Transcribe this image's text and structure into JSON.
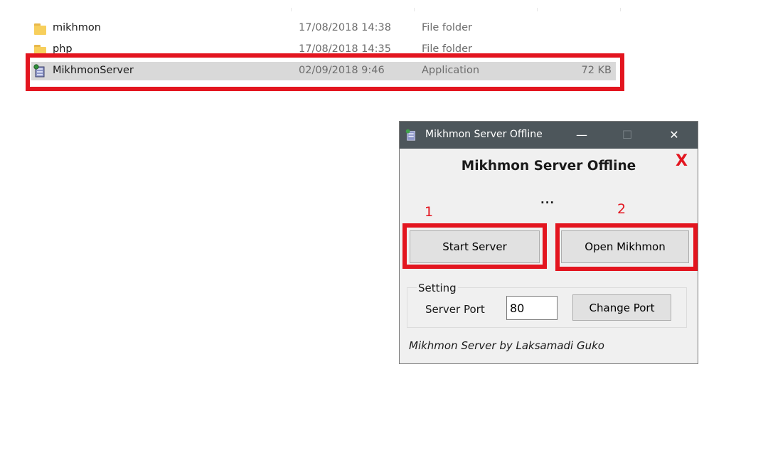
{
  "explorer": {
    "files": [
      {
        "name": "mikhmon",
        "date": "17/08/2018 14:38",
        "type": "File folder",
        "size": "",
        "icon": "folder-icon"
      },
      {
        "name": "php",
        "date": "17/08/2018 14:35",
        "type": "File folder",
        "size": "",
        "icon": "folder-icon"
      },
      {
        "name": "MikhmonServer",
        "date": "02/09/2018 9:46",
        "type": "Application",
        "size": "72 KB",
        "icon": "application-icon"
      }
    ],
    "selected_file": "MikhmonServer"
  },
  "window": {
    "title": "Mikhmon Server Offline",
    "controls": {
      "minimize": "—",
      "maximize": "☐",
      "close": "✕"
    },
    "heading": "Mikhmon Server Offline",
    "x_mark": "X",
    "status": "...",
    "annotation_1": "1",
    "annotation_2": "2",
    "start_button": "Start Server",
    "open_button": "Open Mikhmon",
    "setting_group": "Setting",
    "server_port_label": "Server Port",
    "server_port_value": "80",
    "change_port_button": "Change Port",
    "footer": "Mikhmon Server by  Laksamadi Guko"
  },
  "colors": {
    "highlight": "#e3151f",
    "titlebar": "#4d565b",
    "window_bg": "#f0f0f0",
    "selected_row": "#d9d9d9",
    "folder": "#f7cf5c"
  }
}
